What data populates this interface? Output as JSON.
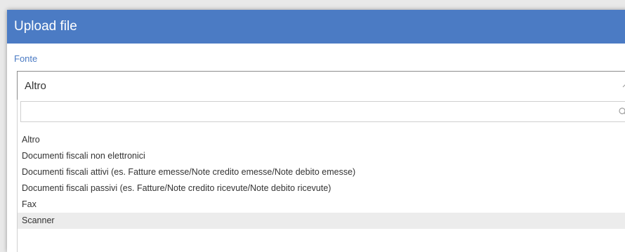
{
  "dialog": {
    "title": "Upload file"
  },
  "fonte": {
    "label": "Fonte",
    "selected": "Altro",
    "search": {
      "value": "",
      "placeholder": ""
    },
    "options": [
      {
        "label": "Altro",
        "highlighted": false
      },
      {
        "label": "Documenti fiscali non elettronici",
        "highlighted": false
      },
      {
        "label": "Documenti fiscali attivi (es. Fatture emesse/Note credito emesse/Note debito emesse)",
        "highlighted": false
      },
      {
        "label": "Documenti fiscali passivi (es. Fatture/Note credito ricevute/Note debito ricevute)",
        "highlighted": false
      },
      {
        "label": "Fax",
        "highlighted": false
      },
      {
        "label": "Scanner",
        "highlighted": true
      }
    ]
  },
  "icons": {
    "caret": "chevron-up-icon",
    "search": "search-icon"
  },
  "colors": {
    "header": "#4b7bc4",
    "label": "#4b7bc4",
    "highlight": "#ececec"
  }
}
